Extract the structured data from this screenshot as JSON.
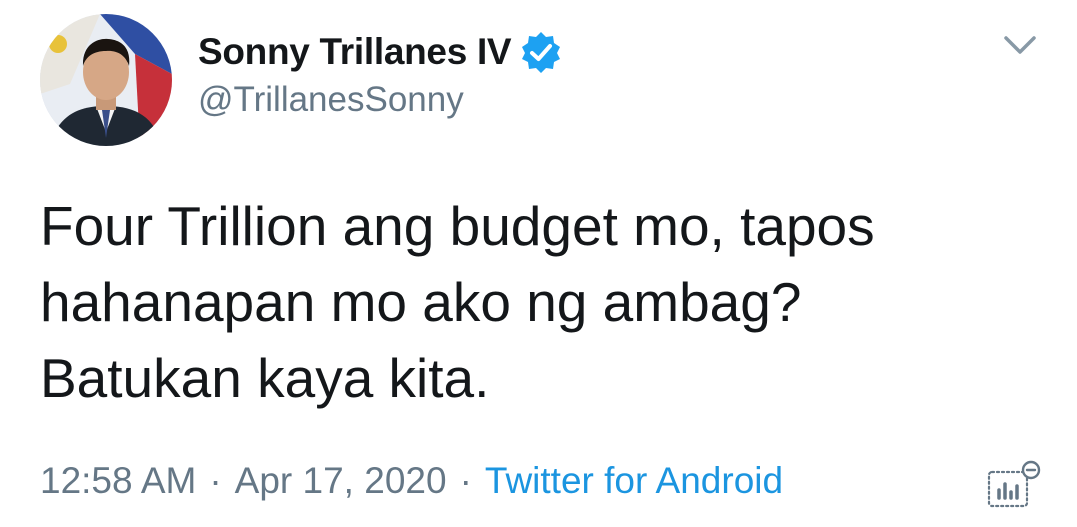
{
  "author": {
    "display_name": "Sonny Trillanes IV",
    "handle": "@TrillanesSonny",
    "verified": true,
    "avatar_icon": "profile-photo"
  },
  "tweet": {
    "text_lines": [
      "Four Trillion ang budget mo, tapos",
      "hahanapan mo ako ng ambag?",
      "Batukan kaya kita."
    ],
    "time": "12:58 AM",
    "date": "Apr 17, 2020",
    "separator": "·",
    "source": "Twitter for Android"
  },
  "icons": {
    "verified": "verified-badge-icon",
    "menu": "chevron-down-icon",
    "analytics": "analytics-icon"
  },
  "colors": {
    "text": "#14171a",
    "secondary": "#657786",
    "link": "#1b95e0",
    "verified": "#1da1f2"
  }
}
